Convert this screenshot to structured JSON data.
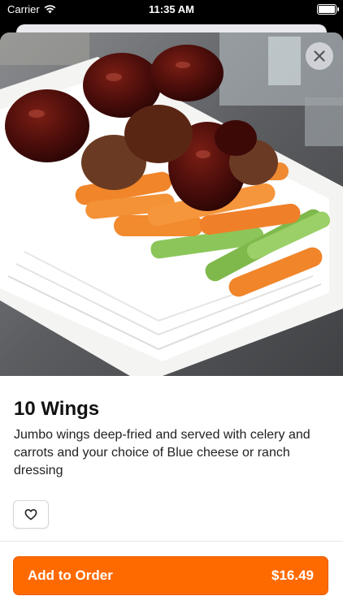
{
  "status_bar": {
    "carrier": "Carrier",
    "time": "11:35 AM"
  },
  "item": {
    "name": "10 Wings",
    "description": "Jumbo wings deep-fried and served with celery and carrots and your choice of Blue cheese or ranch dressing"
  },
  "actions": {
    "add_to_order_label": "Add to Order",
    "price": "$16.49"
  },
  "colors": {
    "accent": "#ff6a00",
    "sauce": "#4a0d0a",
    "carrot": "#f0852a",
    "celery": "#8cc65a"
  },
  "icons": [
    "wifi-icon",
    "battery-icon",
    "close-icon",
    "heart-icon"
  ]
}
